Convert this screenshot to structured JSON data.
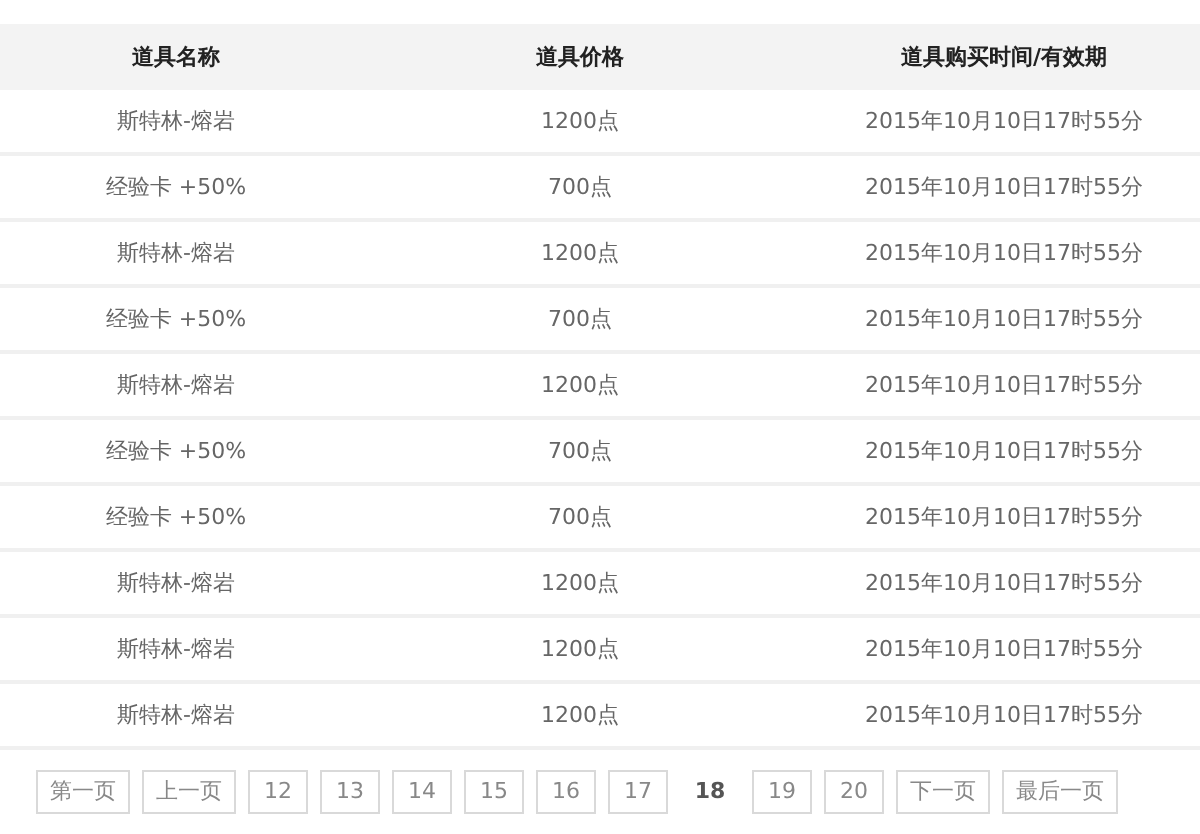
{
  "table": {
    "columns": [
      "道具名称",
      "道具价格",
      "道具购买时间/有效期"
    ],
    "rows": [
      [
        "斯特林-熔岩",
        "1200点",
        "2015年10月10日17时55分"
      ],
      [
        "经验卡 +50%",
        "700点",
        "2015年10月10日17时55分"
      ],
      [
        "斯特林-熔岩",
        "1200点",
        "2015年10月10日17时55分"
      ],
      [
        "经验卡 +50%",
        "700点",
        "2015年10月10日17时55分"
      ],
      [
        "斯特林-熔岩",
        "1200点",
        "2015年10月10日17时55分"
      ],
      [
        "经验卡 +50%",
        "700点",
        "2015年10月10日17时55分"
      ],
      [
        "经验卡 +50%",
        "700点",
        "2015年10月10日17时55分"
      ],
      [
        "斯特林-熔岩",
        "1200点",
        "2015年10月10日17时55分"
      ],
      [
        "斯特林-熔岩",
        "1200点",
        "2015年10月10日17时55分"
      ],
      [
        "斯特林-熔岩",
        "1200点",
        "2015年10月10日17时55分"
      ]
    ]
  },
  "pagination": [
    {
      "label": "第一页",
      "selected": false
    },
    {
      "label": "上一页",
      "selected": false
    },
    {
      "label": "12",
      "selected": false
    },
    {
      "label": "13",
      "selected": false
    },
    {
      "label": "14",
      "selected": false
    },
    {
      "label": "15",
      "selected": false
    },
    {
      "label": "16",
      "selected": false
    },
    {
      "label": "17",
      "selected": false
    },
    {
      "label": "18",
      "selected": true
    },
    {
      "label": "19",
      "selected": false
    },
    {
      "label": "20",
      "selected": false
    },
    {
      "label": "下一页",
      "selected": false
    },
    {
      "label": "最后一页",
      "selected": false
    }
  ]
}
